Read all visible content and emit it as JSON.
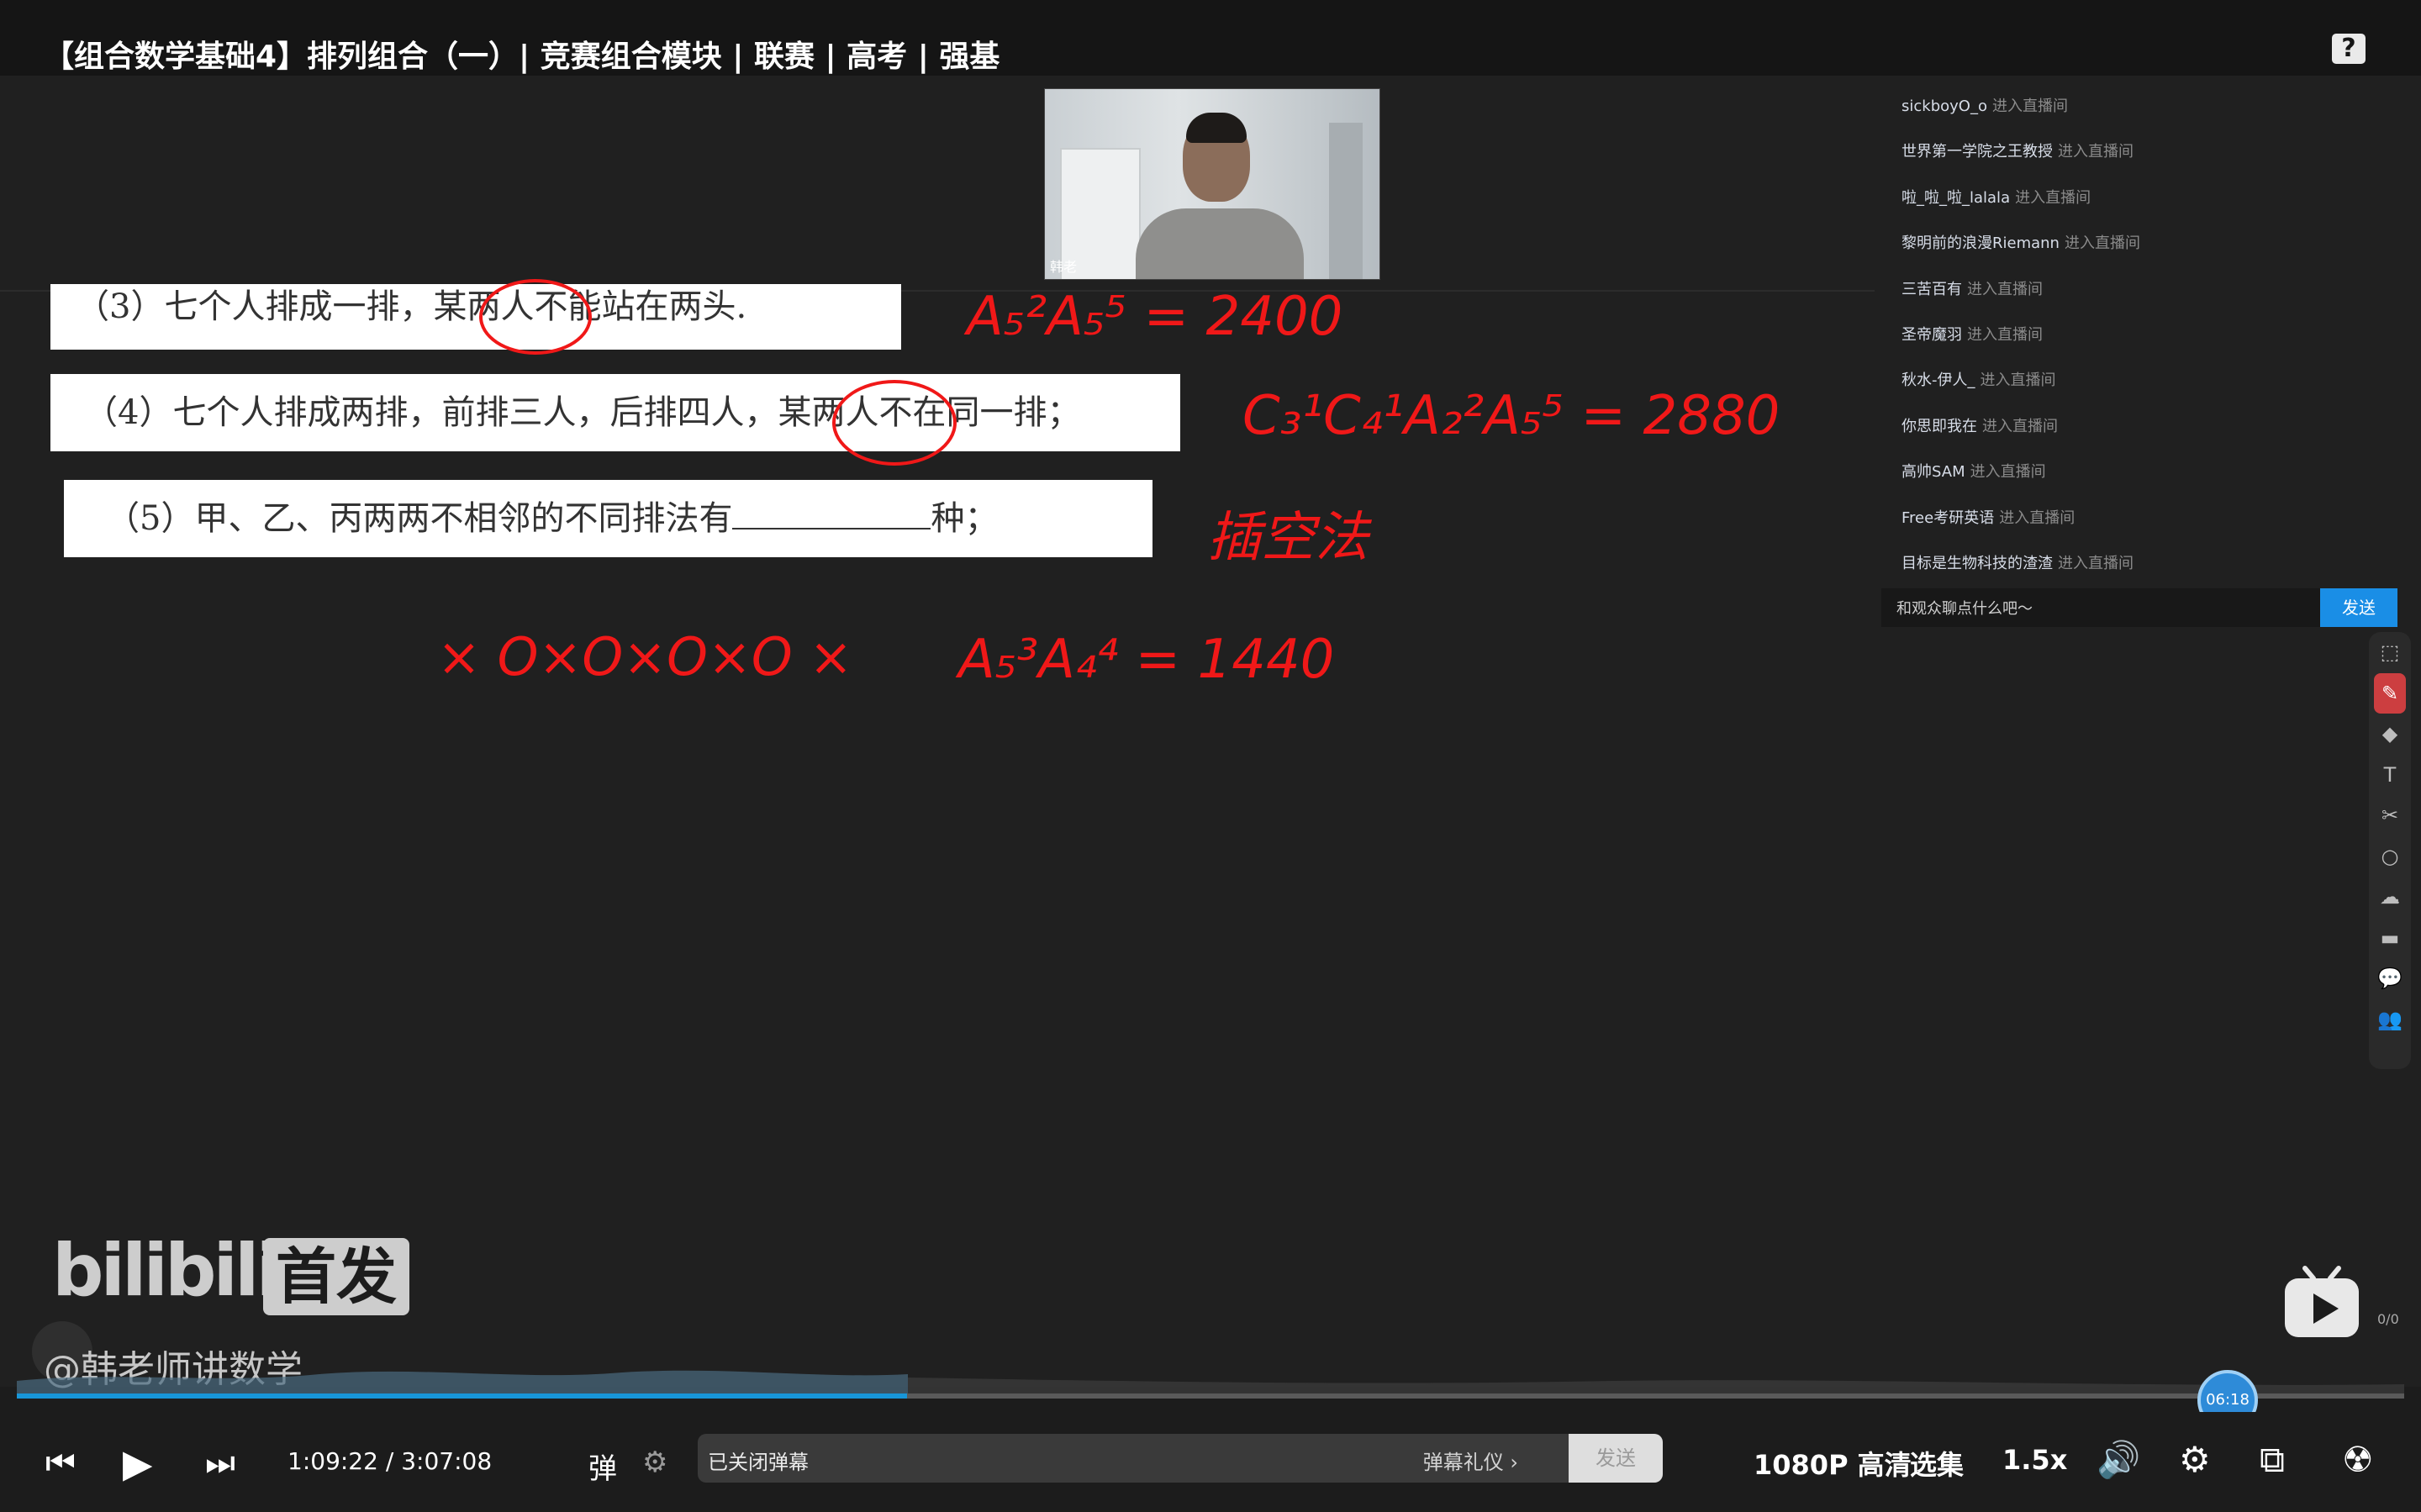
{
  "title": "【组合数学基础4】排列组合（一）| 竞赛组合模块 | 联赛 | 高考 | 强基",
  "help_glyph": "?",
  "camera": {
    "name_tag": "韩老"
  },
  "problems": {
    "p3": "（3）七个人排成一排，某两人不能站在两头.",
    "p4": "（4）七个人排成两排，前排三人，后排四人，某两人不在同一排；",
    "p5_prefix": "（5）甲、乙、丙两两不相邻的不同排法有",
    "p5_suffix": "种；"
  },
  "handwriting": {
    "ans3": "A₅²A₅⁵ = 2400",
    "ans4": "C₃¹C₄¹A₂²A₅⁵ = 2880",
    "method": "插空法",
    "slots": "× O×O×O×O ×",
    "ans5": "A₅³A₄⁴ = 1440"
  },
  "chat": {
    "items": [
      {
        "name": "sickboyO_o",
        "action": "进入直播间"
      },
      {
        "name": "世界第一学院之王教授",
        "action": "进入直播间"
      },
      {
        "name": "啦_啦_啦_lalala",
        "action": "进入直播间"
      },
      {
        "name": "黎明前的浪漫Riemann",
        "action": "进入直播间"
      },
      {
        "name": "三苦百有",
        "action": "进入直播间"
      },
      {
        "name": "圣帝魔羽",
        "action": "进入直播间"
      },
      {
        "name": "秋水-伊人_",
        "action": "进入直播间"
      },
      {
        "name": "你思即我在",
        "action": "进入直播间"
      },
      {
        "name": "高帅SAM",
        "action": "进入直播间"
      },
      {
        "name": "Free考研英语",
        "action": "进入直播间"
      },
      {
        "name": "目标是生物科技的渣渣",
        "action": "进入直播间"
      }
    ],
    "placeholder": "和观众聊点什么吧～",
    "send_label": "发送"
  },
  "toolbar": {
    "tools": [
      {
        "name": "select-icon",
        "glyph": "⬚"
      },
      {
        "name": "pen-icon",
        "glyph": "✎"
      },
      {
        "name": "eraser-icon",
        "glyph": "◆"
      },
      {
        "name": "text-icon",
        "glyph": "T"
      },
      {
        "name": "scissors-icon",
        "glyph": "✂"
      },
      {
        "name": "shape-icon",
        "glyph": "○"
      },
      {
        "name": "cloud-icon",
        "glyph": "☁"
      },
      {
        "name": "toolbox-icon",
        "glyph": "▬"
      },
      {
        "name": "comment-icon",
        "glyph": "💬"
      },
      {
        "name": "users-icon",
        "glyph": "👥"
      }
    ]
  },
  "watermark": {
    "logo": "bilibili",
    "tag": "首发",
    "uploader": "@韩老师讲数学"
  },
  "side_counter": "0/0",
  "progress": {
    "fraction": 0.373,
    "knob_label": "06:18"
  },
  "controls": {
    "current_time": "1:09:22",
    "separator": "/",
    "total_time": "3:07:08",
    "danmaku_closed": "已关闭弹幕",
    "danmaku_etiquette": "弹幕礼仪 ›",
    "danmaku_send": "发送",
    "quality": "1080P 高清",
    "episodes": "选集",
    "speed": "1.5x"
  },
  "colors": {
    "accent": "#1896d8",
    "ink": "#f01818",
    "send": "#1a8ee6"
  }
}
